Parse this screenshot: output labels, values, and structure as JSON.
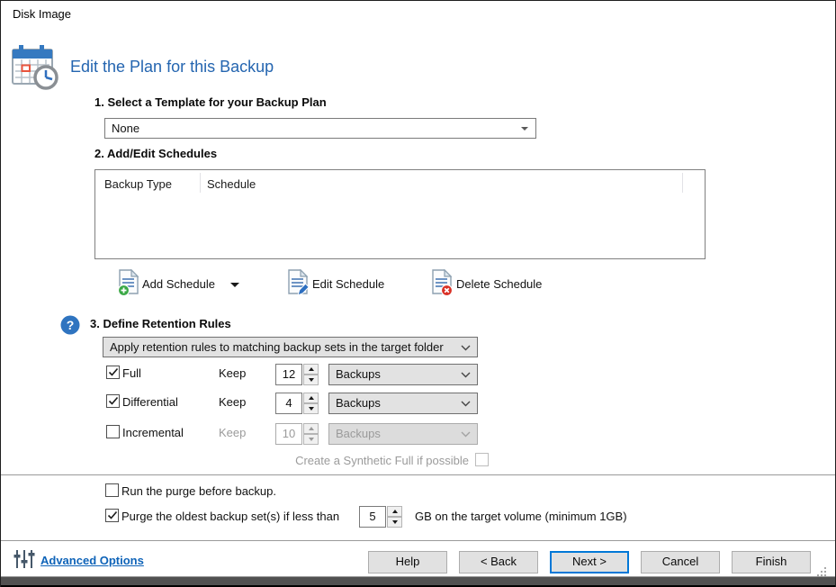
{
  "window": {
    "title": "Disk Image"
  },
  "header": {
    "title": "Edit the Plan for this Backup"
  },
  "icons": {
    "header": "calendar-clock-icon",
    "help": "help-question-icon",
    "add": "document-plus-icon",
    "edit": "document-pencil-icon",
    "delete": "document-delete-icon",
    "advanced": "sliders-icon"
  },
  "template_section": {
    "heading": "1. Select a Template for your Backup Plan",
    "value": "None"
  },
  "schedules_section": {
    "heading": "2. Add/Edit Schedules",
    "columns": {
      "type": "Backup Type",
      "schedule": "Schedule"
    },
    "rows": [],
    "add_label": "Add Schedule",
    "edit_label": "Edit Schedule",
    "delete_label": "Delete Schedule"
  },
  "retention_section": {
    "heading": "3. Define Retention Rules",
    "mode_value": "Apply retention rules to matching backup sets in the target folder",
    "rows": [
      {
        "label": "Full",
        "checked": true,
        "enabled": true,
        "keep_label": "Keep",
        "count": "12",
        "unit": "Backups"
      },
      {
        "label": "Differential",
        "checked": true,
        "enabled": true,
        "keep_label": "Keep",
        "count": "4",
        "unit": "Backups"
      },
      {
        "label": "Incremental",
        "checked": false,
        "enabled": false,
        "keep_label": "Keep",
        "count": "10",
        "unit": "Backups"
      }
    ],
    "synthetic": {
      "label": "Create a Synthetic Full if possible",
      "checked": false,
      "enabled": false
    }
  },
  "purge_section": {
    "run_purge": {
      "label": "Run the purge before backup.",
      "checked": false
    },
    "purge_oldest": {
      "label": "Purge the oldest backup set(s) if less than",
      "checked": true,
      "value": "5",
      "suffix": "GB on the target volume (minimum 1GB)"
    }
  },
  "footer": {
    "advanced_options": "Advanced Options",
    "help": "Help",
    "back": "< Back",
    "next": "Next >",
    "cancel": "Cancel",
    "finish": "Finish"
  },
  "colors": {
    "heading_blue": "#2465b0",
    "link_blue": "#0e63b8",
    "focus_blue": "#0078d7",
    "add_green": "#3aa845",
    "delete_red": "#d93025",
    "pencil_blue": "#2d6fc0",
    "combo_gray": "#e2e2e2",
    "disabled_gray": "#9b9b9b"
  }
}
